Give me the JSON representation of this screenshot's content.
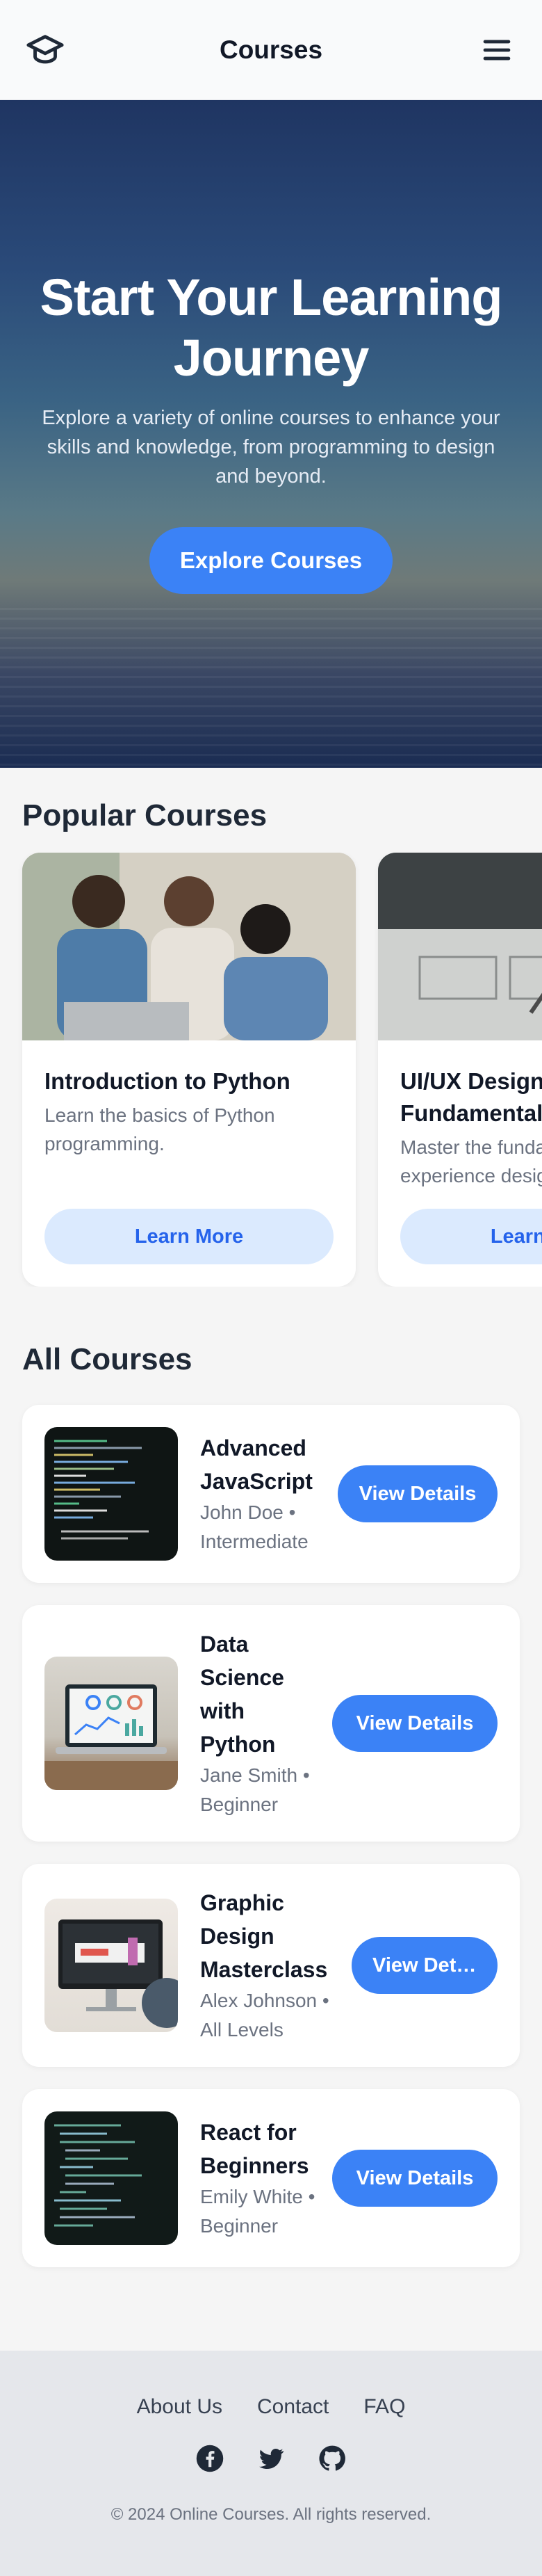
{
  "header": {
    "title": "Courses",
    "logo_icon": "graduation-cap-icon",
    "menu_icon": "hamburger-menu-icon"
  },
  "hero": {
    "title": "Start Your Learning Journey",
    "subtitle": "Explore a variety of online courses to enhance your skills and knowledge, from programming to design and beyond.",
    "cta_label": "Explore Courses"
  },
  "popular": {
    "title": "Popular Courses",
    "courses": [
      {
        "name": "Introduction to Python",
        "description": "Learn the basics of Python programming.",
        "button": "Learn More"
      },
      {
        "name": "UI/UX Design Fundamentals",
        "description": "Master the fundamentals of user experience design.",
        "button": "Learn More"
      }
    ]
  },
  "all_courses": {
    "title": "All Courses",
    "courses": [
      {
        "name": "Advanced JavaScript",
        "meta": "John Doe • Intermediate",
        "button": "View Details"
      },
      {
        "name": "Data Science with Python",
        "meta": "Jane Smith • Beginner",
        "button": "View Details"
      },
      {
        "name": "Graphic Design Masterclass",
        "meta": "Alex Johnson • All Levels",
        "button": "View Details"
      },
      {
        "name": "React for Beginners",
        "meta": "Emily White • Beginner",
        "button": "View Details"
      }
    ]
  },
  "footer": {
    "links": [
      "About Us",
      "Contact",
      "FAQ"
    ],
    "social_icons": [
      "facebook-icon",
      "twitter-icon",
      "github-icon"
    ],
    "copyright": "© 2024 Online Courses. All rights reserved."
  },
  "colors": {
    "primary": "#3b82f6",
    "primary_light": "#dbeafe",
    "text_dark": "#111827",
    "text_muted": "#6b7280"
  }
}
